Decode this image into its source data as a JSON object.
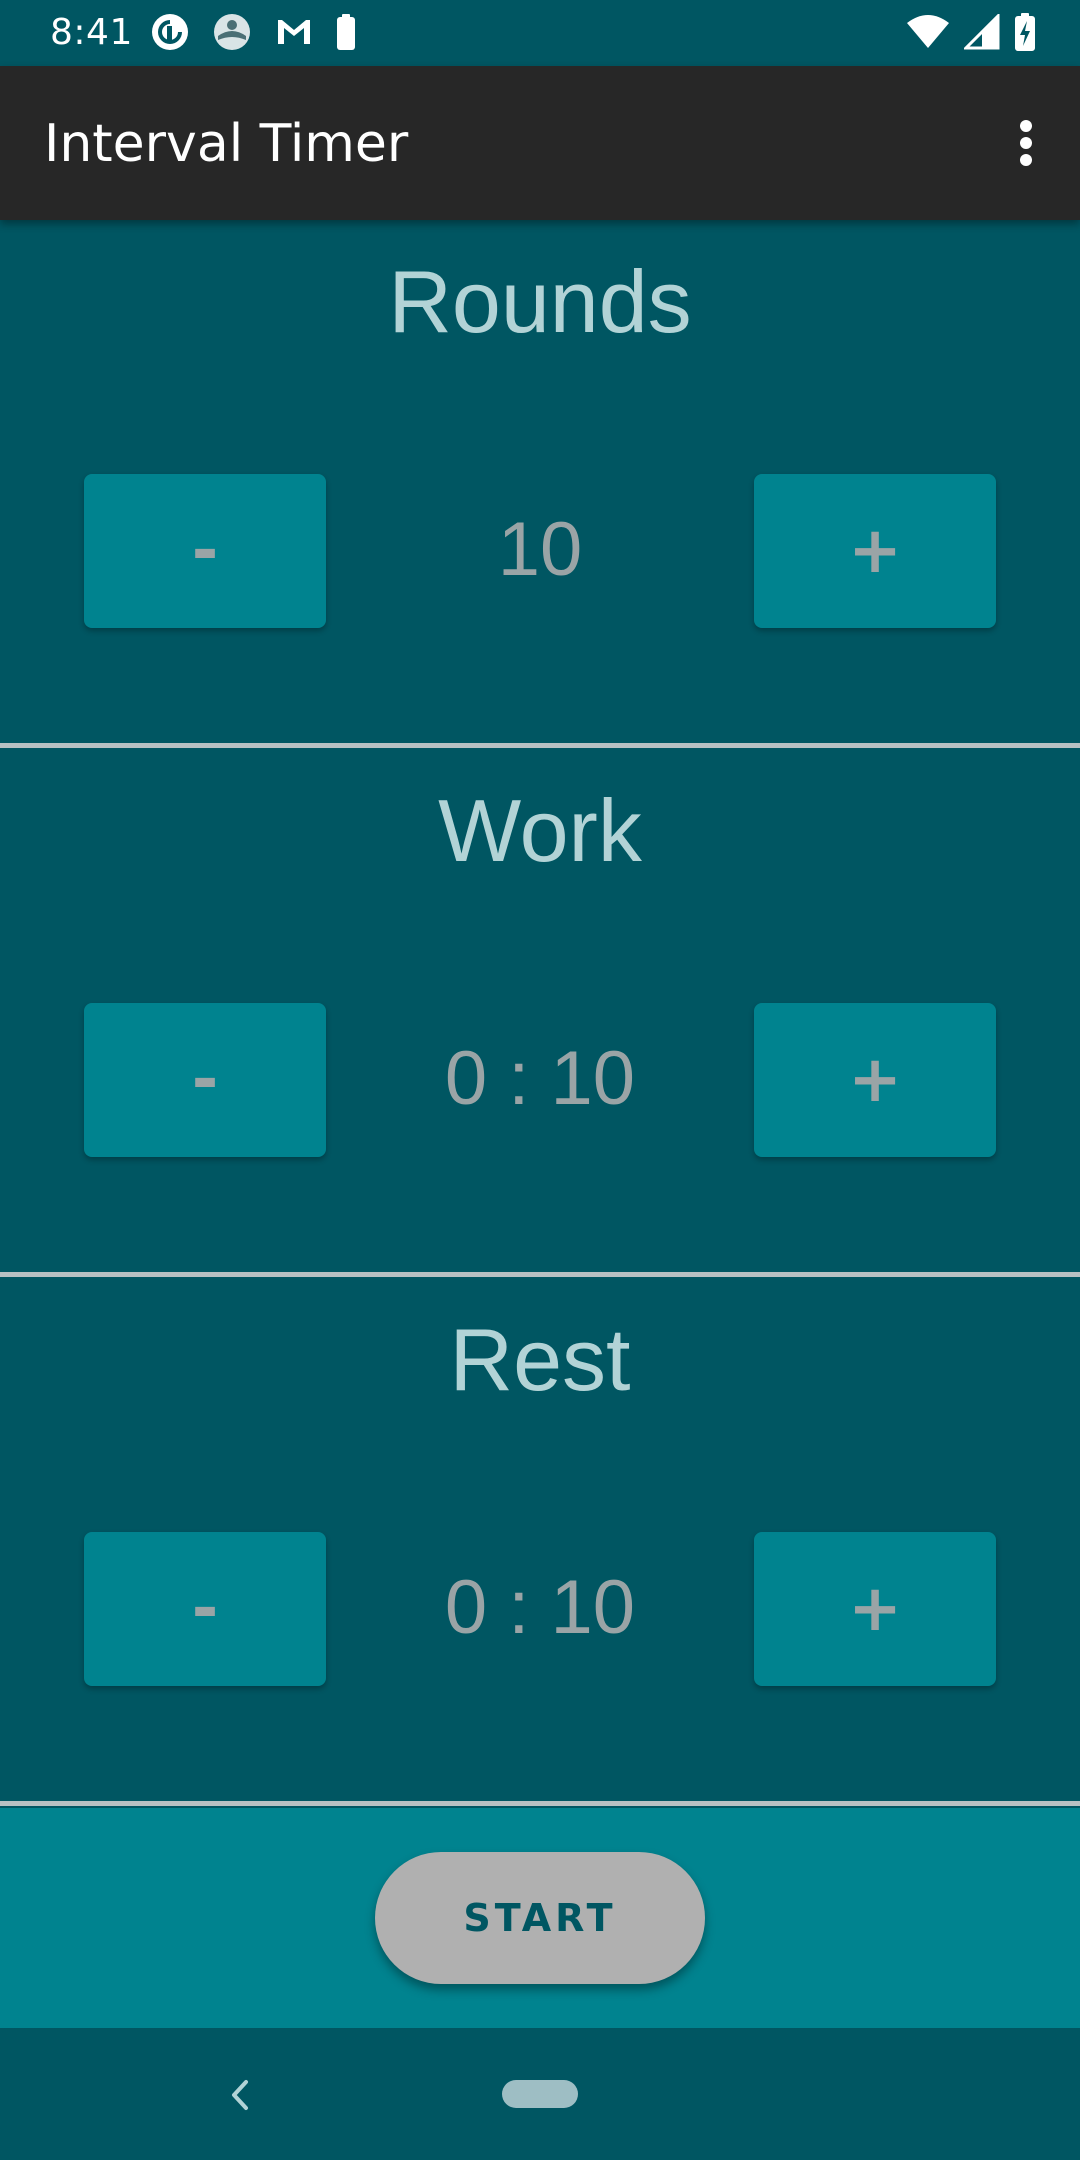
{
  "status_bar": {
    "time": "8:41",
    "left_icons": [
      "pocket-casts-icon",
      "weather-app-icon",
      "gmail-icon",
      "battery-saver-icon"
    ],
    "right_icons": [
      "wifi-icon",
      "cell-signal-icon",
      "battery-charging-icon"
    ]
  },
  "app_bar": {
    "title": "Interval Timer",
    "menu_icon": "more-vert-icon"
  },
  "sections": [
    {
      "title": "Rounds",
      "value": "10",
      "minus_label": "-",
      "plus_label": "+"
    },
    {
      "title": "Work",
      "value": "0 : 10",
      "minus_label": "-",
      "plus_label": "+"
    },
    {
      "title": "Rest",
      "value": "0 : 10",
      "minus_label": "-",
      "plus_label": "+"
    }
  ],
  "start_button": {
    "label": "START"
  },
  "nav_bar": {
    "back_icon": "back-chevron-icon",
    "home_icon": "home-pill-icon"
  },
  "colors": {
    "background": "#005662",
    "app_bar": "#272727",
    "button": "#00838f",
    "title_text": "#b2d3d6",
    "value_text": "#9aa4a6",
    "divider": "#b7c1c3",
    "start_button": "#b0b0b0"
  }
}
